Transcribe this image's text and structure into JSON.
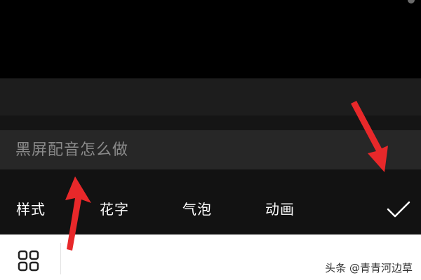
{
  "input": {
    "placeholder": "黑屏配音怎么做"
  },
  "tabs": [
    {
      "label": "样式"
    },
    {
      "label": "花字"
    },
    {
      "label": "气泡"
    },
    {
      "label": "动画"
    }
  ],
  "watermark": "头条 @青青河边草",
  "colors": {
    "background": "#000000",
    "panel": "#121212",
    "input": "#272727",
    "text": "#ffffff",
    "arrow": "#e8282a"
  },
  "icons": {
    "confirm": "checkmark-icon",
    "grid": "grid-icon",
    "annotation": "red-arrow"
  }
}
